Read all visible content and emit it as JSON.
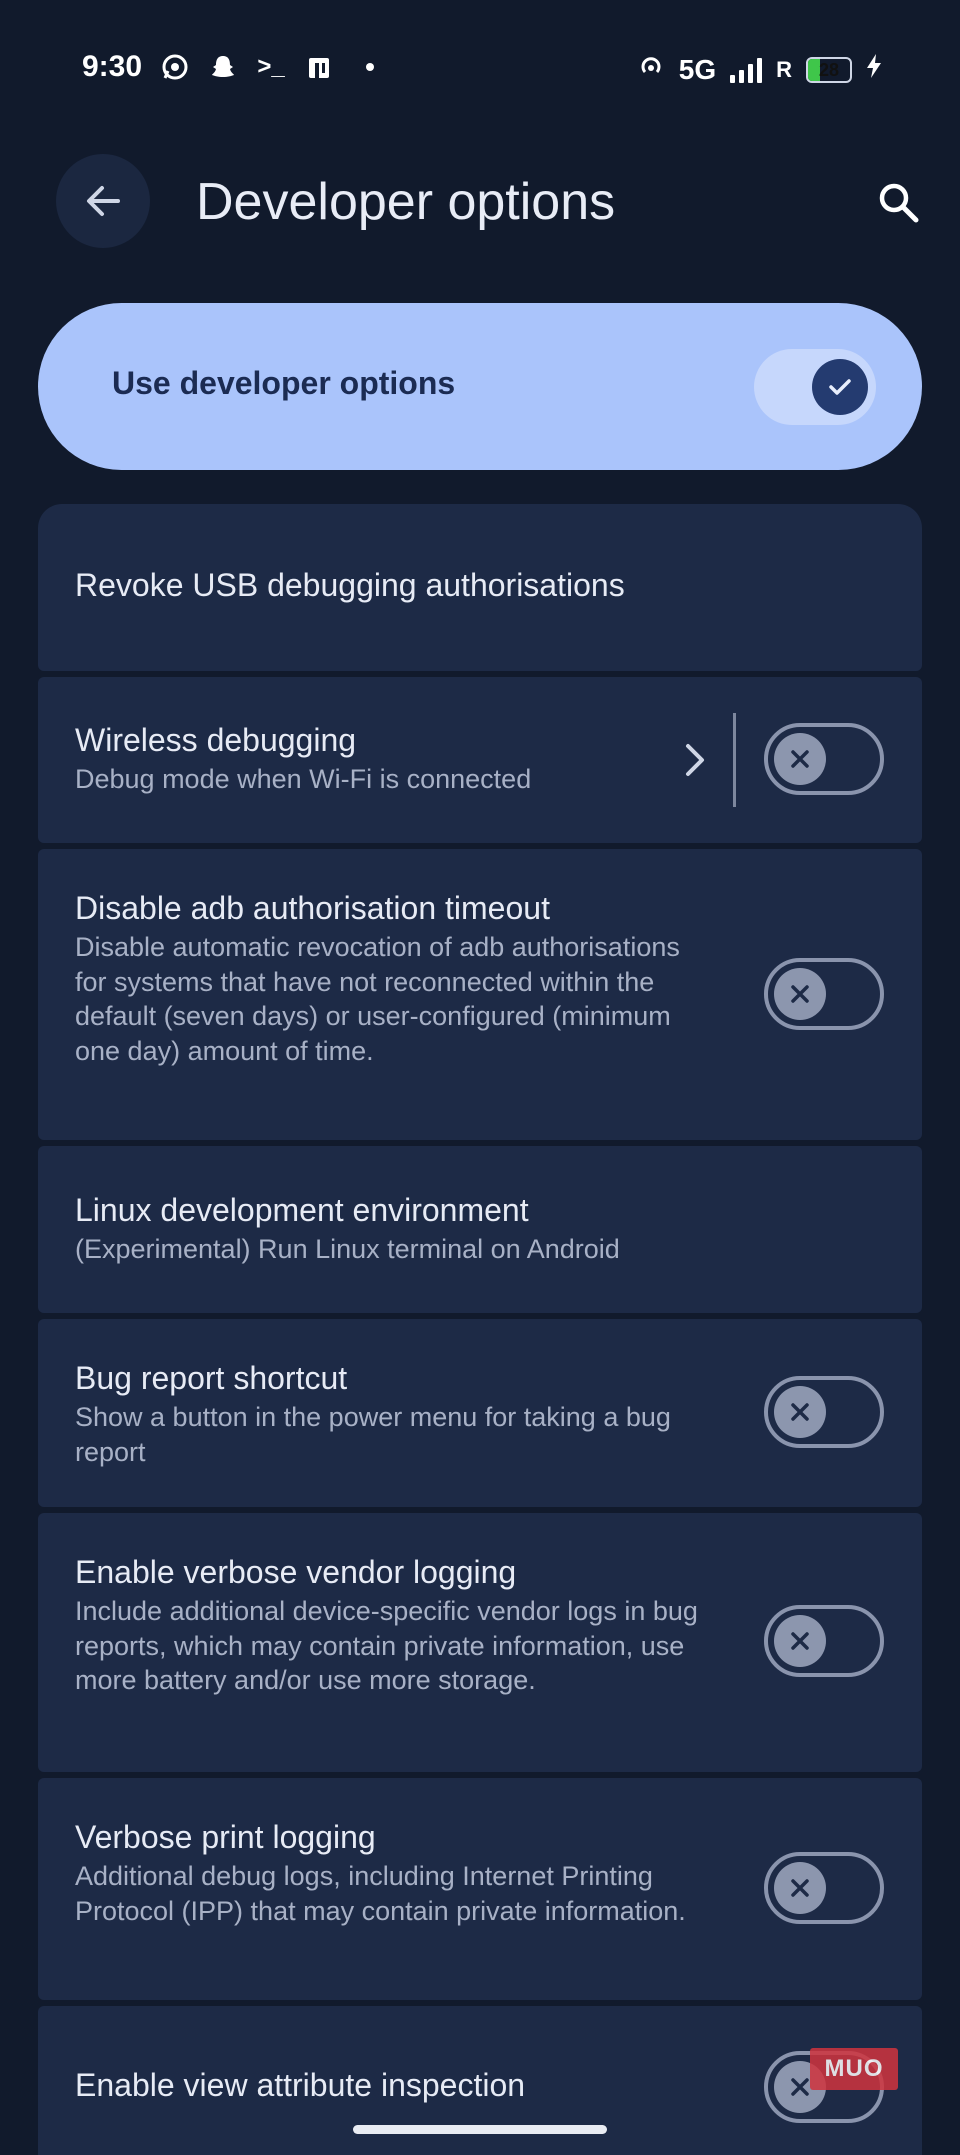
{
  "status_bar": {
    "time": "9:30",
    "terminal_glyph": ">_",
    "network": "5G",
    "roaming": "R",
    "battery_level": "28",
    "battery_fraction": 0.28,
    "icons": [
      "whatsapp-icon",
      "snapchat-icon",
      "terminal-icon",
      "clipboard-icon",
      "hotspot-icon",
      "signal-icon",
      "battery-icon",
      "charging-icon"
    ]
  },
  "app_bar": {
    "title": "Developer options",
    "back_icon": "arrow-left-icon",
    "search_icon": "search-icon"
  },
  "master_toggle": {
    "label": "Use developer options",
    "checked": true
  },
  "settings": [
    {
      "title": "Revoke USB debugging authorisations",
      "subtitle": ""
    },
    {
      "title": "Wireless debugging",
      "subtitle": "Debug mode when Wi-Fi is connected",
      "checked": false
    },
    {
      "title": "Disable adb authorisation timeout",
      "subtitle": "Disable automatic revocation of adb authorisations for systems that have not reconnected within the default (seven days) or user-configured (minimum one day) amount of time.",
      "checked": false
    },
    {
      "title": "Linux development environment",
      "subtitle": "(Experimental) Run Linux terminal on Android"
    },
    {
      "title": "Bug report shortcut",
      "subtitle": "Show a button in the power menu for taking a bug report",
      "checked": false
    },
    {
      "title": "Enable verbose vendor logging",
      "subtitle": "Include additional device-specific vendor logs in bug reports, which may contain private information, use more battery and/or use more storage.",
      "checked": false
    },
    {
      "title": "Verbose print logging",
      "subtitle": "Additional debug logs, including Internet Printing Protocol (IPP) that may contain private information.",
      "checked": false
    },
    {
      "title": "Enable view attribute inspection",
      "subtitle": "",
      "checked": false
    }
  ],
  "watermark": "MUO",
  "colors": {
    "background": "#111a2c",
    "card": "#1d2a46",
    "accent": "#aac4fb",
    "accent_dark": "#243b70"
  }
}
